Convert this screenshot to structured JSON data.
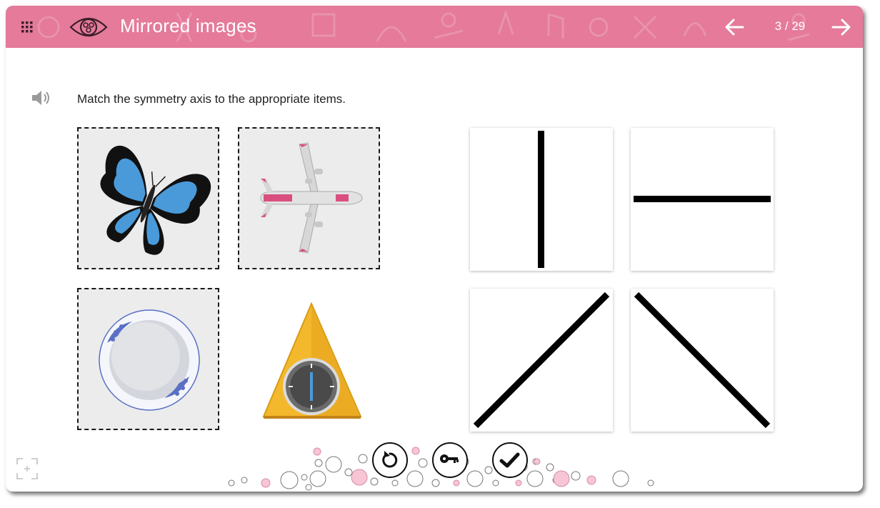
{
  "header": {
    "title": "Mirrored images",
    "page_counter": "3 / 29",
    "background_color": "#e57a9b",
    "icons": {
      "menu": "grid-menu-icon",
      "logo": "eye-icon",
      "prev": "arrow-left-icon",
      "next": "arrow-right-icon"
    }
  },
  "task": {
    "instruction": "Match the symmetry axis to the appropriate items.",
    "speaker_icon": "speaker-icon"
  },
  "items": [
    {
      "name": "butterfly",
      "in_slot": true
    },
    {
      "name": "airplane",
      "in_slot": true
    },
    {
      "name": "plate",
      "in_slot": true
    },
    {
      "name": "triangle-clock",
      "in_slot": false
    }
  ],
  "axis_cards": [
    {
      "name": "vertical-axis"
    },
    {
      "name": "horizontal-axis"
    },
    {
      "name": "diagonal-rising-axis"
    },
    {
      "name": "diagonal-falling-axis"
    }
  ],
  "controls": {
    "reset_icon": "reset-icon",
    "key_icon": "key-icon",
    "check_icon": "check-icon",
    "fullscreen_icon": "fullscreen-icon"
  },
  "colors": {
    "accent": "#e57a9b",
    "bubble_pink": "#f6c6d5",
    "butterfly_blue": "#4a9ad9",
    "airplane_pink": "#d94f80",
    "triangle_yellow": "#f3b82b"
  }
}
